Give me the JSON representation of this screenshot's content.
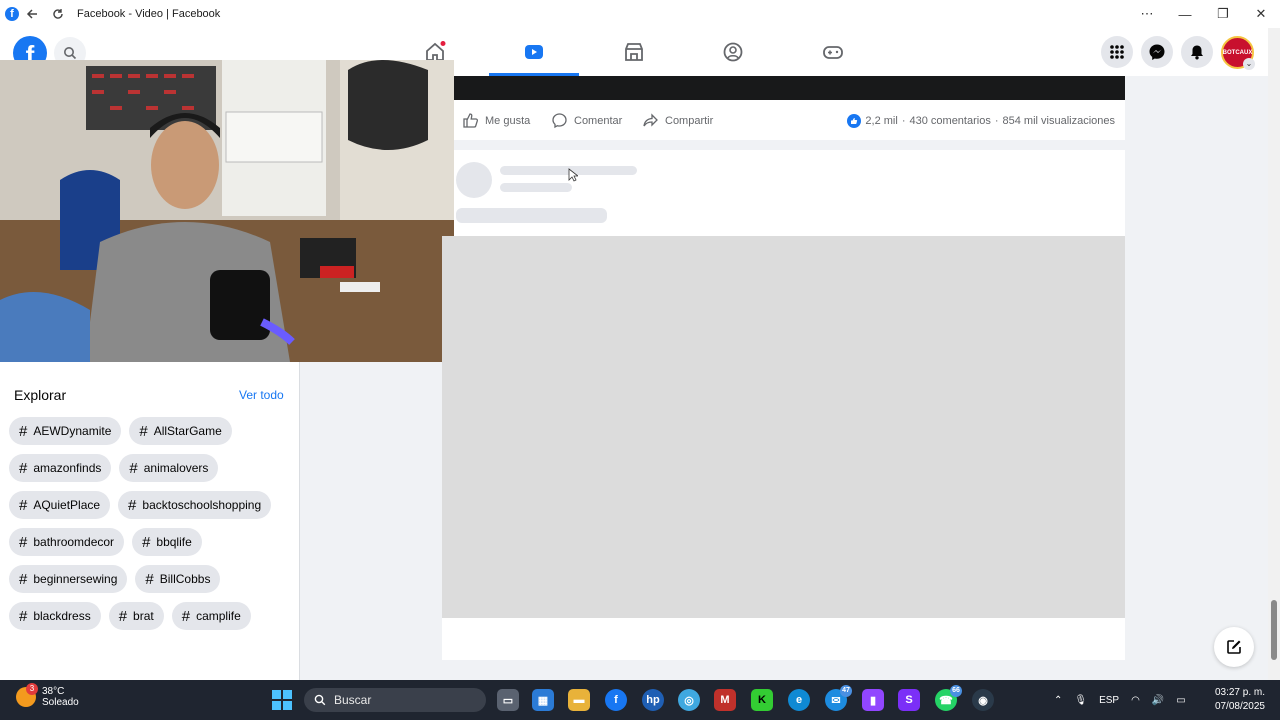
{
  "window": {
    "title": "Facebook - Video | Facebook"
  },
  "explore": {
    "heading": "Explorar",
    "see_all": "Ver todo",
    "tags": [
      [
        "AEWDynamite",
        "AllStarGame"
      ],
      [
        "amazonfinds",
        "animalovers"
      ],
      [
        "AQuietPlace",
        "backtoschoolshopping"
      ],
      [
        "bathroomdecor",
        "bbqlife"
      ],
      [
        "beginnersewing",
        "BillCobbs"
      ],
      [
        "blackdress",
        "brat",
        "camplife"
      ]
    ]
  },
  "post_actions": {
    "like": "Me gusta",
    "comment": "Comentar",
    "share": "Compartir",
    "reactions": "2,2 mil",
    "comments": "430 comentarios",
    "separator": "·",
    "views": "854 mil visualizaciones"
  },
  "profile": {
    "avatar_text": "BOTCAUX"
  },
  "taskbar": {
    "weather_temp": "38°C",
    "weather_desc": "Soleado",
    "weather_badge": "3",
    "search_placeholder": "Buscar",
    "messenger_badge": "47",
    "whatsapp_badge": "66",
    "language": "ESP",
    "time": "03:27 p. m.",
    "date": "07/08/2025"
  },
  "colors": {
    "brand": "#1877f2",
    "taskbar": "#1f2530"
  }
}
